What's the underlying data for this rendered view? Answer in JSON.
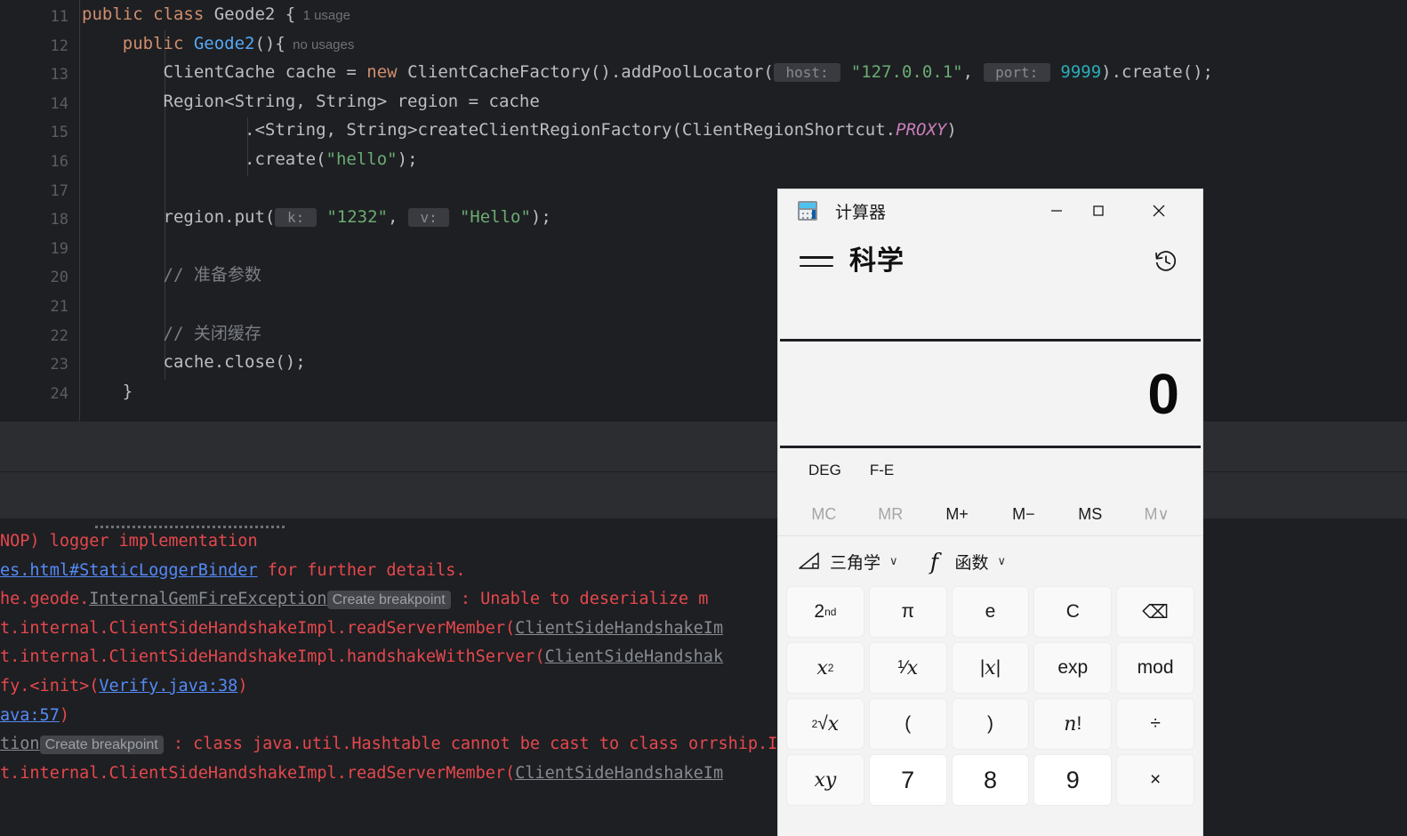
{
  "editor": {
    "lines": [
      {
        "num": "11",
        "tokens": [
          {
            "t": "public ",
            "c": "kw"
          },
          {
            "t": "class ",
            "c": "kw"
          },
          {
            "t": "Geode2 {",
            "c": "cls"
          },
          {
            "t": "  1 usage",
            "c": "usage"
          }
        ]
      },
      {
        "num": "12",
        "tokens": [
          {
            "t": "    public ",
            "c": "kw"
          },
          {
            "t": "Geode2",
            "c": "fn"
          },
          {
            "t": "(){",
            "c": "cls"
          },
          {
            "t": "  no usages",
            "c": "usage"
          }
        ]
      },
      {
        "num": "13",
        "tokens": [
          {
            "t": "        ClientCache cache = ",
            "c": "cls"
          },
          {
            "t": "new ",
            "c": "kw"
          },
          {
            "t": "ClientCacheFactory().addPoolLocator(",
            "c": "cls"
          },
          {
            "t": " host: ",
            "c": "hint"
          },
          {
            "t": " ",
            "c": "cls"
          },
          {
            "t": "\"127.0.0.1\"",
            "c": "str"
          },
          {
            "t": ", ",
            "c": "cls"
          },
          {
            "t": " port: ",
            "c": "hint"
          },
          {
            "t": " ",
            "c": "cls"
          },
          {
            "t": "9999",
            "c": "num"
          },
          {
            "t": ").create();",
            "c": "cls"
          }
        ]
      },
      {
        "num": "14",
        "tokens": [
          {
            "t": "        Region<String, String> region = cache",
            "c": "cls"
          }
        ]
      },
      {
        "num": "15",
        "tokens": [
          {
            "t": "                .<String, String>createClientRegionFactory(ClientRegionShortcut.",
            "c": "cls"
          },
          {
            "t": "PROXY",
            "c": "stat"
          },
          {
            "t": ")",
            "c": "cls"
          }
        ]
      },
      {
        "num": "16",
        "tokens": [
          {
            "t": "                .create(",
            "c": "cls"
          },
          {
            "t": "\"hello\"",
            "c": "str"
          },
          {
            "t": ");",
            "c": "cls"
          }
        ]
      },
      {
        "num": "17",
        "tokens": []
      },
      {
        "num": "18",
        "tokens": [
          {
            "t": "        region.put(",
            "c": "cls"
          },
          {
            "t": " k: ",
            "c": "hint"
          },
          {
            "t": " ",
            "c": "cls"
          },
          {
            "t": "\"1232\"",
            "c": "str"
          },
          {
            "t": ", ",
            "c": "cls"
          },
          {
            "t": " v: ",
            "c": "hint"
          },
          {
            "t": " ",
            "c": "cls"
          },
          {
            "t": "\"Hello\"",
            "c": "str"
          },
          {
            "t": ");",
            "c": "cls"
          }
        ]
      },
      {
        "num": "19",
        "tokens": []
      },
      {
        "num": "20",
        "tokens": [
          {
            "t": "        // 准备参数",
            "c": "cmt"
          }
        ]
      },
      {
        "num": "21",
        "tokens": []
      },
      {
        "num": "22",
        "tokens": [
          {
            "t": "        // 关闭缓存",
            "c": "cmt"
          }
        ]
      },
      {
        "num": "23",
        "tokens": [
          {
            "t": "        cache.close();",
            "c": "cls"
          }
        ]
      },
      {
        "num": "24",
        "tokens": [
          {
            "t": "    }",
            "c": "cls"
          }
        ]
      }
    ]
  },
  "console": {
    "lines": [
      [
        {
          "t": "NOP) logger implementation",
          "c": "err"
        }
      ],
      [
        {
          "t": "es.html#StaticLoggerBinder",
          "c": "lnk"
        },
        {
          "t": " for further details.",
          "c": "err"
        }
      ],
      [
        {
          "t": "he.geode.",
          "c": "err"
        },
        {
          "t": "InternalGemFireException",
          "c": "grey-lnk"
        },
        {
          "t": "Create breakpoint",
          "c": "bp"
        },
        {
          "t": " : ",
          "c": "err"
        },
        {
          "t": "Unable to deserialize m",
          "c": "err"
        }
      ],
      [
        {
          "t": "t.internal.ClientSideHandshakeImpl.readServerMember(",
          "c": "err"
        },
        {
          "t": "ClientSideHandshakeIm",
          "c": "grey-lnk"
        }
      ],
      [
        {
          "t": "t.internal.ClientSideHandshakeImpl.handshakeWithServer(",
          "c": "err"
        },
        {
          "t": "ClientSideHandshak",
          "c": "grey-lnk"
        }
      ],
      [
        {
          "t": "fy.<init>(",
          "c": "err"
        },
        {
          "t": "Verify.java:38",
          "c": "lnk"
        },
        {
          "t": ")",
          "c": "err"
        }
      ],
      [
        {
          "t": "ava:57",
          "c": "lnk"
        },
        {
          "t": ")",
          "c": "err"
        }
      ],
      [
        {
          "t": "tion",
          "c": "grey-lnk"
        },
        {
          "t": "Create breakpoint",
          "c": "bp"
        },
        {
          "t": " : class java.util.Hashtable cannot be cast to class or",
          "c": "err"
        },
        {
          "t": "rship.InternalDist",
          "c": "err"
        }
      ],
      [
        {
          "t": "t.internal.ClientSideHandshakeImpl.readServerMember(",
          "c": "err"
        },
        {
          "t": "ClientSideHandshakeIm",
          "c": "grey-lnk"
        }
      ]
    ]
  },
  "calculator": {
    "window_title": "计算器",
    "app_icon": "calculator-icon",
    "window_buttons": {
      "minimize": "—",
      "maximize": "☐",
      "close": "✕"
    },
    "mode_title": "科学",
    "menu_icon": "hamburger-icon",
    "history_icon": "history-icon",
    "display_value": "0",
    "mode_chips": [
      "DEG",
      "F-E"
    ],
    "memory_buttons": [
      {
        "label": "MC",
        "disabled": true
      },
      {
        "label": "MR",
        "disabled": true
      },
      {
        "label": "M+",
        "disabled": false
      },
      {
        "label": "M−",
        "disabled": false
      },
      {
        "label": "MS",
        "disabled": false
      },
      {
        "label": "M∨",
        "disabled": true
      }
    ],
    "function_groups": [
      {
        "icon": "triangle-icon",
        "label": "三角学",
        "chevron": "∨"
      },
      {
        "icon": "function-f-icon",
        "label": "函数",
        "chevron": "∨"
      }
    ],
    "keys": [
      {
        "label": "2nd",
        "html": "2<sup>nd</sup>",
        "kind": "fn"
      },
      {
        "label": "π",
        "html": "π",
        "kind": "fn"
      },
      {
        "label": "e",
        "html": "e",
        "kind": "fn"
      },
      {
        "label": "C",
        "html": "C",
        "kind": "fn"
      },
      {
        "label": "backspace",
        "html": "⌫",
        "kind": "fn"
      },
      {
        "label": "x²",
        "html": "<span class='ital'>x</span><sup>2</sup>",
        "kind": "fn"
      },
      {
        "label": "1/x",
        "html": "¹⁄<span class='ital'>x</span>",
        "kind": "fn"
      },
      {
        "label": "|x|",
        "html": "|<span class='ital'>x</span>|",
        "kind": "fn"
      },
      {
        "label": "exp",
        "html": "exp",
        "kind": "fn"
      },
      {
        "label": "mod",
        "html": "mod",
        "kind": "fn"
      },
      {
        "label": "sqrt",
        "html": "<sup>2</sup>√<span class='ital'>x</span>",
        "kind": "fn"
      },
      {
        "label": "(",
        "html": "(",
        "kind": "fn"
      },
      {
        "label": ")",
        "html": ")",
        "kind": "fn"
      },
      {
        "label": "n!",
        "html": "<span class='ital'>n</span>!",
        "kind": "fn"
      },
      {
        "label": "divide",
        "html": "÷",
        "kind": "fn"
      },
      {
        "label": "x^y",
        "html": "<span class='ital'>x</span><sup><span class='ital'>y</span></sup>",
        "kind": "fn"
      },
      {
        "label": "7",
        "html": "7",
        "kind": "num"
      },
      {
        "label": "8",
        "html": "8",
        "kind": "num"
      },
      {
        "label": "9",
        "html": "9",
        "kind": "num"
      },
      {
        "label": "multiply",
        "html": "×",
        "kind": "fn"
      }
    ]
  },
  "colors": {
    "ide_bg": "#1e1f22",
    "panel_bg": "#2b2d30",
    "calc_bg": "#f3f3f3",
    "error_red": "#e5484d",
    "link_blue": "#548af7",
    "string_green": "#6aab73",
    "keyword_orange": "#cf8e6d",
    "number_teal": "#2aacb8"
  }
}
